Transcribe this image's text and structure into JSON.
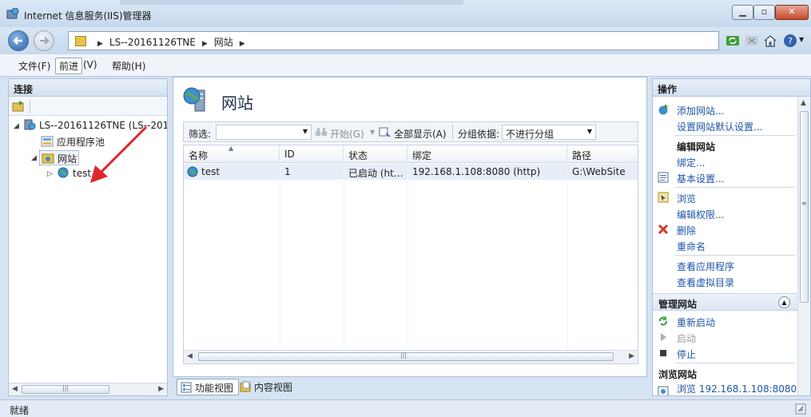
{
  "window": {
    "title": "Internet 信息服务(IIS)管理器"
  },
  "address": {
    "crumbs": [
      "LS--20161126TNE",
      "网站"
    ]
  },
  "menu": {
    "items": [
      "文件(F)",
      "前进",
      "(V)",
      "帮助(H)"
    ]
  },
  "left": {
    "header": "连接",
    "tree": [
      {
        "label": "LS--20161126TNE (LS--201"
      },
      {
        "label": "应用程序池"
      },
      {
        "label": "网站"
      },
      {
        "label": "test"
      }
    ]
  },
  "center": {
    "title": "网站",
    "filter": {
      "label": "筛选:",
      "start": "开始(G)",
      "show_all": "全部显示(A)",
      "group_label": "分组依据:",
      "group_value": "不进行分组"
    },
    "columns": [
      "名称",
      "ID",
      "状态",
      "绑定",
      "路径"
    ],
    "rows": [
      {
        "name": "test",
        "id": "1",
        "status": "已启动 (ht…",
        "binding": "192.168.1.108:8080 (http)",
        "path": "G:\\WebSite"
      }
    ]
  },
  "tabs": {
    "features": "功能视图",
    "content": "内容视图"
  },
  "right": {
    "header": "操作",
    "actions1": [
      "添加网站...",
      "设置网站默认设置..."
    ],
    "edit_head": "编辑网站",
    "actions2": [
      "绑定...",
      "基本设置...",
      "浏览",
      "编辑权限...",
      "删除",
      "重命名",
      "查看应用程序",
      "查看虚拟目录"
    ],
    "manage_head": "管理网站",
    "actions3": [
      "重新启动",
      "启动",
      "停止"
    ],
    "browse_head": "浏览网站",
    "browse_link": "浏览 192.168.1.108:8080"
  },
  "status": {
    "text": "就绪"
  },
  "colors": {
    "link": "#1d55a6",
    "arrow": "#e0262b"
  }
}
